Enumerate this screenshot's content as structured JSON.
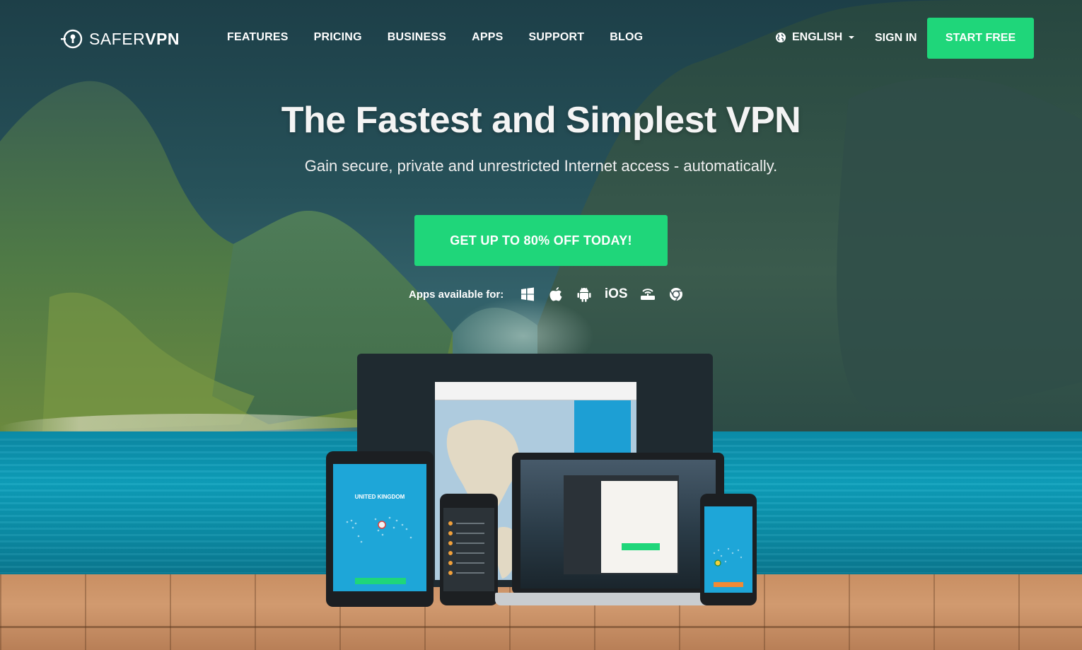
{
  "brand": {
    "name_light": "SAFER",
    "name_bold": "VPN"
  },
  "nav": {
    "items": [
      {
        "label": "FEATURES"
      },
      {
        "label": "PRICING"
      },
      {
        "label": "BUSINESS"
      },
      {
        "label": "APPS"
      },
      {
        "label": "SUPPORT"
      },
      {
        "label": "BLOG"
      }
    ],
    "language": "ENGLISH",
    "sign_in": "SIGN IN",
    "start_free": "START FREE"
  },
  "hero": {
    "title": "The Fastest and Simplest VPN",
    "subtitle": "Gain secure, private and unrestricted Internet access - automatically.",
    "cta": "GET UP TO 80% OFF TODAY!",
    "apps_label": "Apps available for:",
    "platforms": [
      {
        "icon": "windows-icon"
      },
      {
        "icon": "apple-icon"
      },
      {
        "icon": "android-icon"
      },
      {
        "icon": "ios-icon",
        "text": "iOS"
      },
      {
        "icon": "router-icon"
      },
      {
        "icon": "chrome-icon"
      }
    ]
  },
  "devices": {
    "tablet_location": "UNITED KINGDOM"
  },
  "colors": {
    "accent": "#1fd67a",
    "app_blue": "#1ea6d8"
  }
}
